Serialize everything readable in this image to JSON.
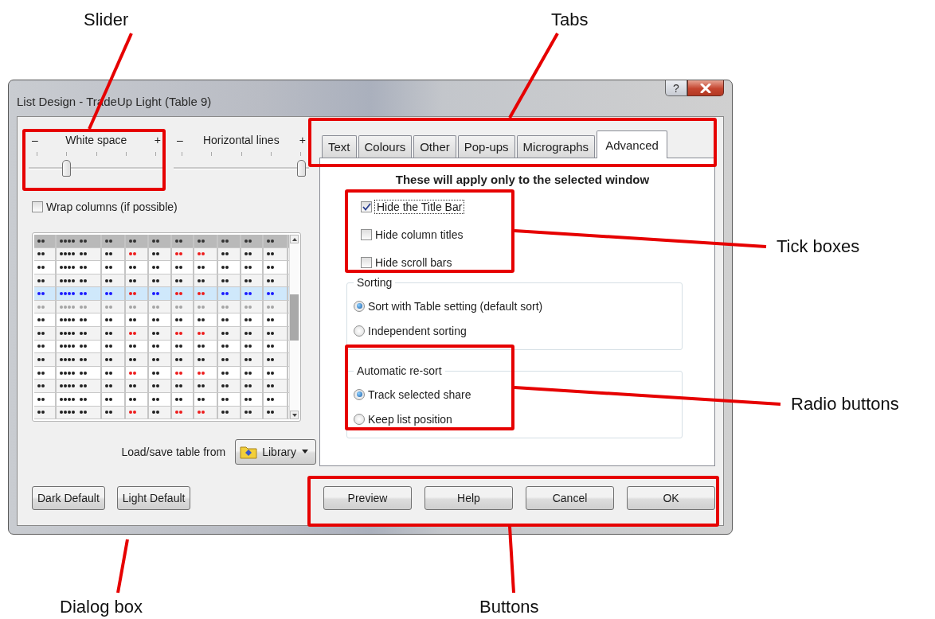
{
  "window": {
    "title": "List Design - TradeUp Light (Table 9)",
    "help_glyph": "?"
  },
  "sliders": [
    {
      "minus": "–",
      "label": "White space",
      "plus": "+",
      "level": 0.25
    },
    {
      "minus": "–",
      "label": "Horizontal lines",
      "plus": "+",
      "level": 1
    }
  ],
  "wrap_columns": {
    "label": "Wrap columns (if possible)",
    "checked": false
  },
  "load_save": {
    "label": "Load/save table from",
    "button": "Library"
  },
  "default_buttons": [
    "Dark Default",
    "Light Default"
  ],
  "tabs": [
    {
      "label": "Text",
      "selected": false
    },
    {
      "label": "Colours",
      "selected": false
    },
    {
      "label": "Other",
      "selected": false
    },
    {
      "label": "Pop-ups",
      "selected": false
    },
    {
      "label": "Micrographs",
      "selected": false
    },
    {
      "label": "Advanced",
      "selected": true
    }
  ],
  "advanced": {
    "heading": "These will apply only to the selected window",
    "options": [
      {
        "label": "Hide the Title Bar",
        "checked": true,
        "focused": true
      },
      {
        "label": "Hide column titles",
        "checked": false,
        "focused": false
      },
      {
        "label": "Hide scroll bars",
        "checked": false,
        "focused": false
      }
    ],
    "groups": [
      {
        "title": "Sorting",
        "options": [
          {
            "label": "Sort with Table setting (default sort)",
            "selected": true
          },
          {
            "label": "Independent sorting",
            "selected": false
          }
        ]
      },
      {
        "title": "Automatic re-sort",
        "options": [
          {
            "label": "Track selected share",
            "selected": true
          },
          {
            "label": "Keep list position",
            "selected": false
          }
        ]
      }
    ]
  },
  "buttons": [
    "Preview",
    "Help",
    "Cancel",
    "OK"
  ],
  "annotations": [
    {
      "label": "Slider"
    },
    {
      "label": "Tabs"
    },
    {
      "label": "Tick boxes"
    },
    {
      "label": "Radio buttons"
    },
    {
      "label": "Dialog box"
    },
    {
      "label": "Buttons"
    }
  ]
}
